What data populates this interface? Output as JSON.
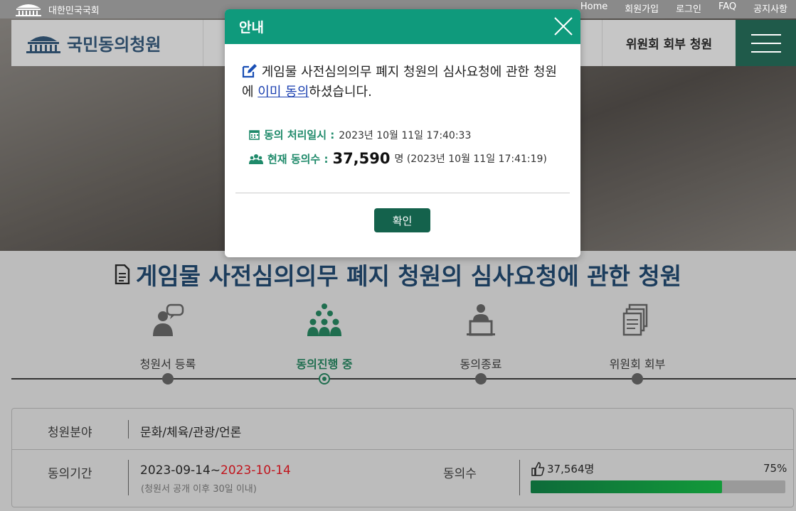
{
  "topbar": {
    "assembly_label": "대한민국국회",
    "links": [
      "Home",
      "회원가입",
      "로그인",
      "FAQ",
      "공지사항"
    ]
  },
  "nav": {
    "logo_text": "국민동의청원",
    "committee_label": "위원회 회부 청원"
  },
  "modal": {
    "title": "안내",
    "message_pre": "게임물 사전심의의무 폐지 청원의 심사요청에 관한 청원에 ",
    "message_link": "이미 동의",
    "message_post": "하셨습니다.",
    "processed_label": "동의 처리일시 :",
    "processed_value": "2023년 10월 11일 17:40:33",
    "count_label": "현재 동의수 :",
    "count_value": "37,590",
    "count_suffix": "명 (2023년 10월 11일 17:41:19)",
    "confirm_label": "확인"
  },
  "page": {
    "title": "게임물 사전심의의무 폐지 청원의 심사요청에 관한 청원"
  },
  "steps": [
    {
      "label": "청원서 등록",
      "active": false
    },
    {
      "label": "동의진행 중",
      "active": true
    },
    {
      "label": "동의종료",
      "active": false
    },
    {
      "label": "위원회 회부",
      "active": false
    }
  ],
  "info": {
    "field_label": "청원분야",
    "field_value": "문화/체육/관광/언론",
    "period_label": "동의기간",
    "period_start": "2023-09-14~",
    "period_end": "2023-10-14",
    "period_note": "(청원서 공개 이후 30일 이내)",
    "count_label": "동의수",
    "count_value": "37,564명",
    "progress_label": "75%",
    "progress": 0.75
  },
  "colors": {
    "brand_green": "#0f9a7c",
    "button_green": "#14624c",
    "title_navy": "#1b3c5c",
    "period_red": "#c0141c"
  }
}
